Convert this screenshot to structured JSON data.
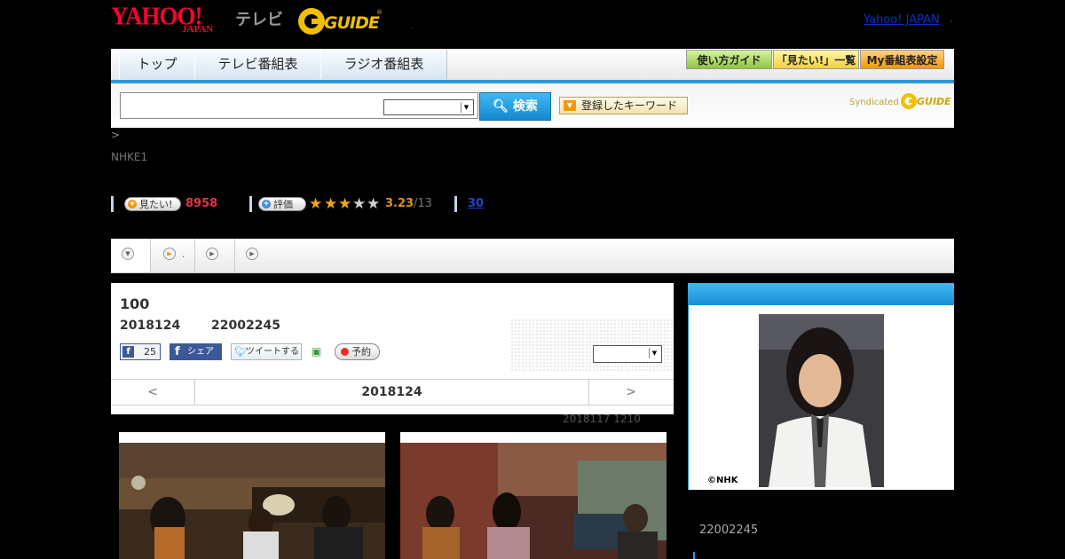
{
  "header": {
    "yahoo_logo": "YAHOO!",
    "yahoo_japan": "JAPAN",
    "tv_label": "テレビ",
    "gguide_logo": "GUIDE",
    "yahoo_japan_link": "Yahoo! JAPAN",
    "dot": "."
  },
  "nav": {
    "tabs": [
      "トップ",
      "テレビ番組表",
      "ラジオ番組表"
    ],
    "buttons": [
      "使い方ガイド",
      "「見たい!」一覧",
      "My番組表設定"
    ]
  },
  "search": {
    "value": "",
    "button_label": "検索",
    "keyword_button_label": "登録したキーワード",
    "syndicated_label": "Syndicated",
    "syndicated_logo": "GUIDE"
  },
  "breadcrumb": ">",
  "channel": "NHKE1",
  "stats": {
    "want_label": "見たい!",
    "want_count": "8958",
    "rate_label": "評価",
    "rating": "3.23",
    "rating_count": "/13",
    "stars_value": 3,
    "stars_max": 5,
    "link_count": "30"
  },
  "subtabs": {
    "second_dot": ".",
    "icons": [
      "triangle-down",
      "play",
      "play",
      "play"
    ]
  },
  "program": {
    "title": "100",
    "date": "2018124",
    "time": "22002245",
    "fb_like_count": "25",
    "fb_share_label": "シェア",
    "tweet_label": "ツイートする",
    "reserve_label": "予約"
  },
  "pager": {
    "prev": "<",
    "date": "2018124",
    "next": ">"
  },
  "updated": "2018117  1210",
  "right_panel": {
    "credit": "©NHK",
    "time": "22002245"
  },
  "colors": {
    "accent_blue": "#2a9bd8",
    "want_red": "#e8304a",
    "rating_orange": "#e09020",
    "facebook": "#3b5998"
  }
}
